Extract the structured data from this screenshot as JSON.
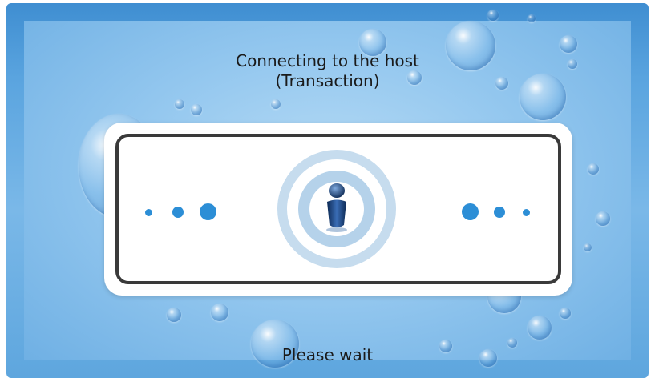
{
  "screen": {
    "title_line1": "Connecting to the host",
    "title_line2": "(Transaction)",
    "footer_text": "Please wait"
  },
  "colors": {
    "background": "#5aa4df",
    "dot": "#2c8ed6",
    "panel_border": "#3a3a3a",
    "ring_outer": "#c9dff0",
    "ring_inner": "#b4d3ec"
  },
  "icons": {
    "center": "person-icon"
  }
}
